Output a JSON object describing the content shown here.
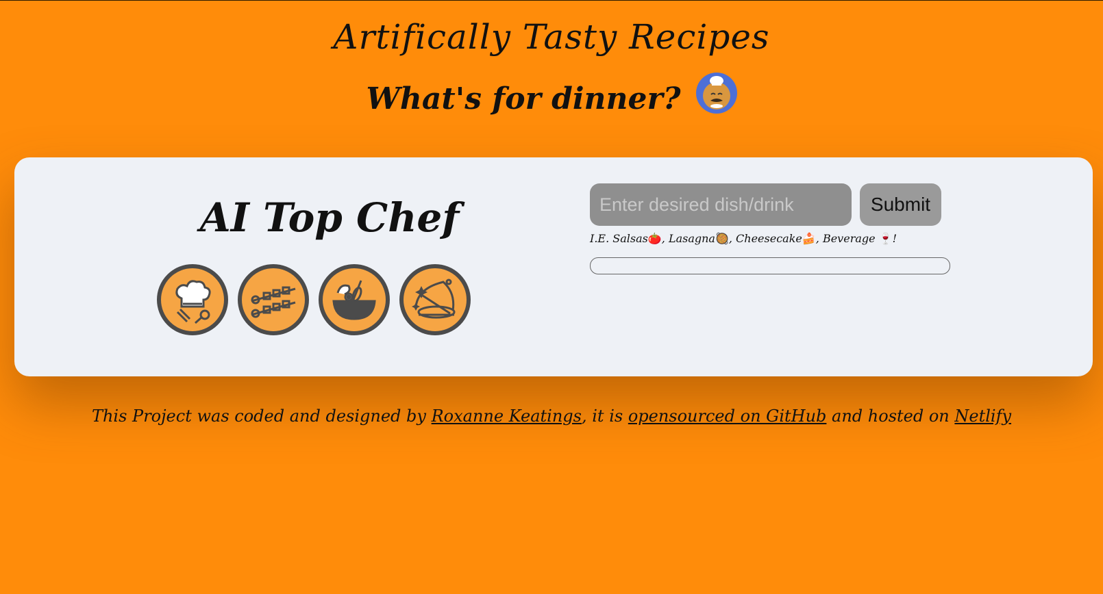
{
  "header": {
    "title": "Artifically Tasty Recipes",
    "subtitle": "What's for dinner?"
  },
  "card": {
    "title": "AI Top Chef",
    "icons": [
      "chef-hat-utensils-icon",
      "skewers-icon",
      "mixing-bowl-icon",
      "serving-platter-icon"
    ]
  },
  "form": {
    "placeholder": "Enter desired dish/drink",
    "submit_label": "Submit",
    "hint_prefix": "I.E. Salsas",
    "hint_salsa_emoji": "🍅",
    "hint_lasagna": ", Lasagna",
    "hint_lasagna_emoji": "🥘",
    "hint_cheesecake": ", Cheesecake",
    "hint_cheesecake_emoji": "🍰",
    "hint_beverage": ", Beverage ",
    "hint_beverage_emoji": "🍷",
    "hint_suffix": "!"
  },
  "footer": {
    "text_1": "This Project was coded and designed by ",
    "author_link": "Roxanne Keatings",
    "text_2": ", it is ",
    "github_link": "opensourced on GitHub",
    "text_3": " and hosted on ",
    "netlify_link": "Netlify"
  },
  "colors": {
    "background": "#ff8c0a",
    "card": "#eef1f6",
    "icon_fill": "#f6a544",
    "icon_stroke": "#4b4b4b",
    "avatar_bg": "#4d6fd6"
  }
}
